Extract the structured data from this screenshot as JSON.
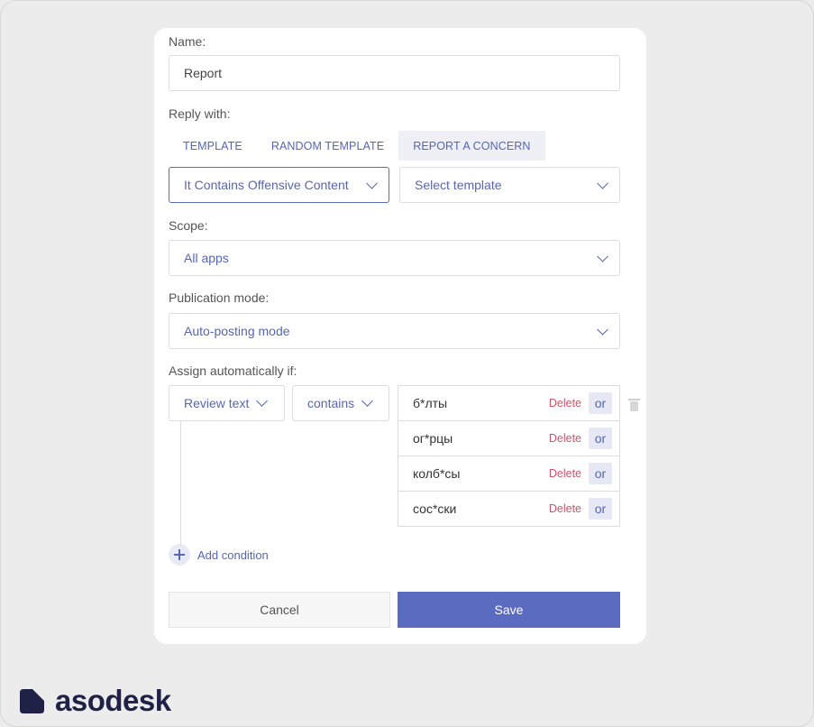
{
  "form": {
    "name_label": "Name:",
    "name_value": "Report",
    "reply_label": "Reply with:",
    "tabs": [
      {
        "label": "TEMPLATE"
      },
      {
        "label": "RANDOM TEMPLATE"
      },
      {
        "label": "REPORT A CONCERN",
        "active": true
      }
    ],
    "concern_select": "It Contains Offensive Content",
    "template_select_placeholder": "Select template",
    "scope_label": "Scope:",
    "scope_value": "All apps",
    "publication_label": "Publication mode:",
    "publication_value": "Auto-posting mode",
    "assign_label": "Assign automatically if:",
    "condition": {
      "field": "Review text",
      "operator": "contains",
      "keywords": [
        "б*лты",
        "ог*рцы",
        "колб*сы",
        "сос*ски"
      ],
      "delete_label": "Delete",
      "or_label": "or"
    },
    "add_condition_label": "Add condition",
    "cancel_label": "Cancel",
    "save_label": "Save"
  },
  "brand": {
    "name": "asodesk",
    "accent_color": "#5a6bc0",
    "logo_color": "#1f2147"
  }
}
